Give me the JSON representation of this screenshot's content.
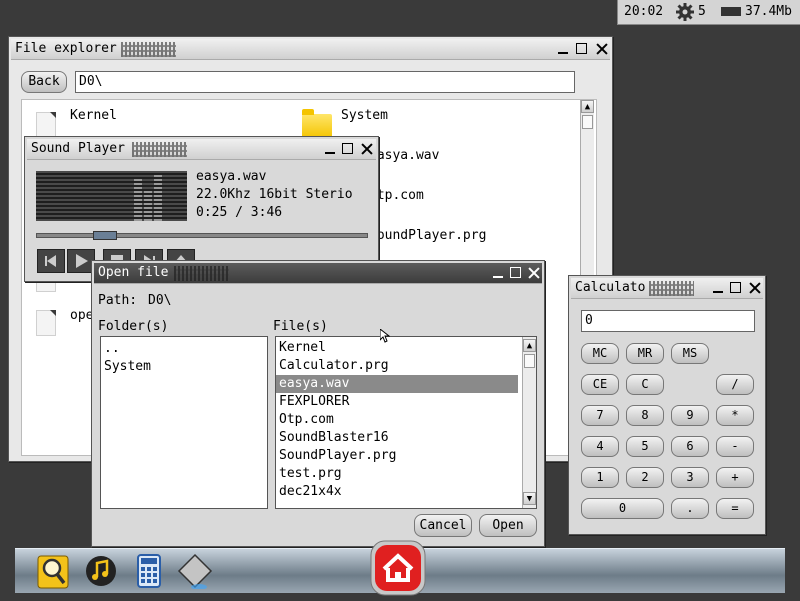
{
  "statusbar": {
    "time": "20:02",
    "cpu_count": "5",
    "memory": "37.4Mb"
  },
  "file_explorer": {
    "title": "File explorer",
    "back_label": "Back",
    "path": "D0\\",
    "items": [
      {
        "name": "Kernel",
        "type": "file"
      },
      {
        "name": "System",
        "type": "folder"
      },
      {
        "name": "easya.wav",
        "type": "file"
      },
      {
        "name": "Otp.com",
        "type": "file"
      },
      {
        "name": "SoundPlayer.prg",
        "type": "file"
      },
      {
        "name": "ope",
        "type": "file"
      }
    ]
  },
  "sound_player": {
    "title": "Sound Player",
    "filename": "easya.wav",
    "format": "22.0Khz 16bit Sterio",
    "time": "0:25 / 3:46",
    "progress": 0.17
  },
  "open_file": {
    "title": "Open file",
    "path_label": "Path:",
    "path": "D0\\",
    "folders_label": "Folder(s)",
    "files_label": "File(s)",
    "folders": [
      "..",
      "System"
    ],
    "files": [
      "Kernel",
      "Calculator.prg",
      "easya.wav",
      "FEXPLORER",
      "Otp.com",
      "SoundBlaster16",
      "SoundPlayer.prg",
      "test.prg",
      "dec21x4x"
    ],
    "selected_file": "easya.wav",
    "cancel_label": "Cancel",
    "open_label": "Open"
  },
  "calculator": {
    "title": "Calculato",
    "display": "0",
    "keys": {
      "mc": "MC",
      "mr": "MR",
      "ms": "MS",
      "ce": "CE",
      "c": "C",
      "div": "/",
      "k7": "7",
      "k8": "8",
      "k9": "9",
      "mul": "*",
      "k4": "4",
      "k5": "5",
      "k6": "6",
      "sub": "-",
      "k1": "1",
      "k2": "2",
      "k3": "3",
      "add": "+",
      "k0": "0",
      "dot": ".",
      "eq": "="
    }
  },
  "taskbar": {
    "icons": [
      "file-explorer-icon",
      "music-icon",
      "calculator-icon",
      "diamond-icon",
      "home-icon"
    ]
  },
  "colors": {
    "accent_home": "#e02020",
    "selection": "#8a8a8a",
    "folder": "#f4c400"
  }
}
